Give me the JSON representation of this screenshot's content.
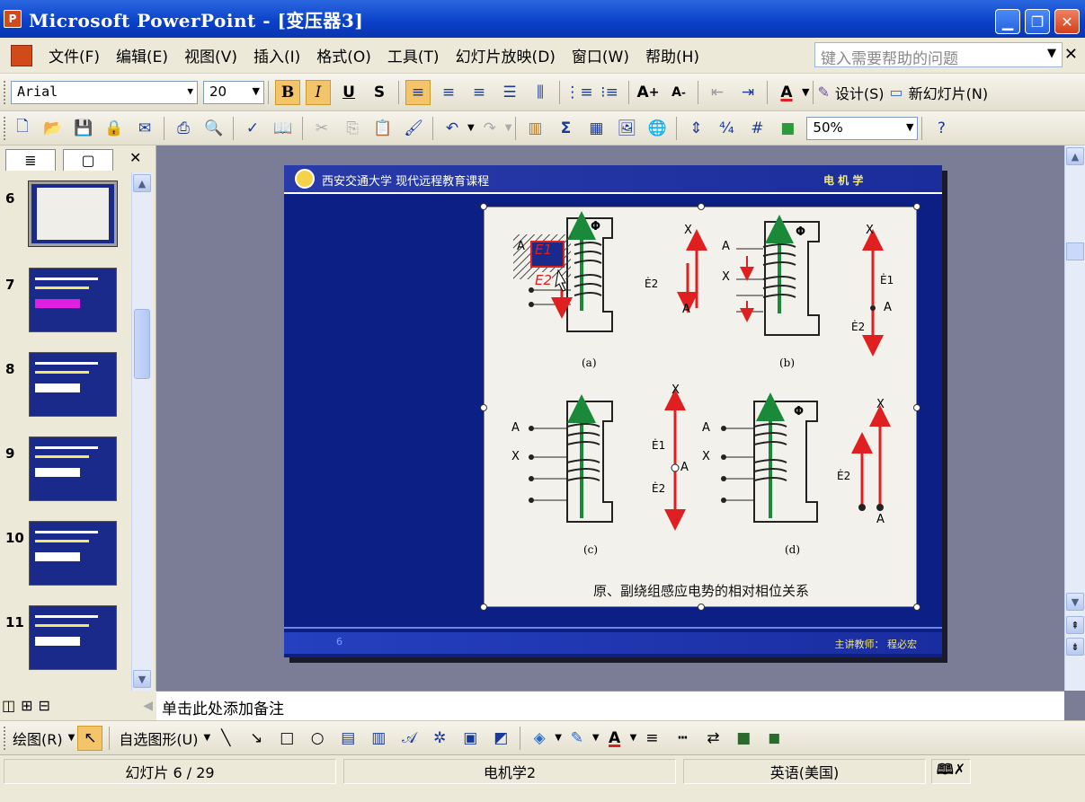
{
  "window": {
    "app_icon_label": "P",
    "title": "Microsoft PowerPoint - [变压器3]"
  },
  "menu": {
    "items": [
      "文件(F)",
      "编辑(E)",
      "视图(V)",
      "插入(I)",
      "格式(O)",
      "工具(T)",
      "幻灯片放映(D)",
      "窗口(W)",
      "帮助(H)"
    ],
    "help_placeholder": "键入需要帮助的问题"
  },
  "format_toolbar": {
    "font_name": "Arial",
    "font_size": "20",
    "bold": "B",
    "italic": "I",
    "underline": "U",
    "shadow": "S",
    "font_color_letter": "A",
    "design_label": "设计(S)",
    "new_slide_label": "新幻灯片(N)"
  },
  "standard_toolbar": {
    "zoom": "50%"
  },
  "slides_panel": {
    "thumbnails": [
      {
        "number": "6",
        "active": true
      },
      {
        "number": "7",
        "active": false
      },
      {
        "number": "8",
        "active": false
      },
      {
        "number": "9",
        "active": false
      },
      {
        "number": "10",
        "active": false
      },
      {
        "number": "11",
        "active": false
      }
    ]
  },
  "slide": {
    "school_header": "西安交通大学 现代远程教育课程",
    "course_name": "电 机 学",
    "page_number": "6",
    "teacher": "主讲教师：   程必宏",
    "figure": {
      "labels": [
        "(a)",
        "(b)",
        "(c)",
        "(d)"
      ],
      "caption": "原、副绕组感应电势的相对相位关系",
      "terminal_A": "A",
      "terminal_X": "X",
      "terminal_a": "a",
      "terminal_x": "x",
      "phi": "Φ",
      "e1_callout": "E1",
      "e2_callout": "E2",
      "e1_label": "Ė1",
      "e2_label": "Ė2"
    }
  },
  "notes": {
    "placeholder": "单击此处添加备注"
  },
  "drawing_toolbar": {
    "draw_label": "绘图(R)",
    "autoshapes_label": "自选图形(U)"
  },
  "status": {
    "slide_info": "幻灯片 6 / 29",
    "design_name": "电机学2",
    "language": "英语(美国)"
  },
  "colors": {
    "titlebar": "#0a3fc7",
    "slide_background": "#0c1f84",
    "accent_yellow": "#f6e86a",
    "flux_green": "#1a8a3a",
    "emf_red": "#e02020"
  }
}
